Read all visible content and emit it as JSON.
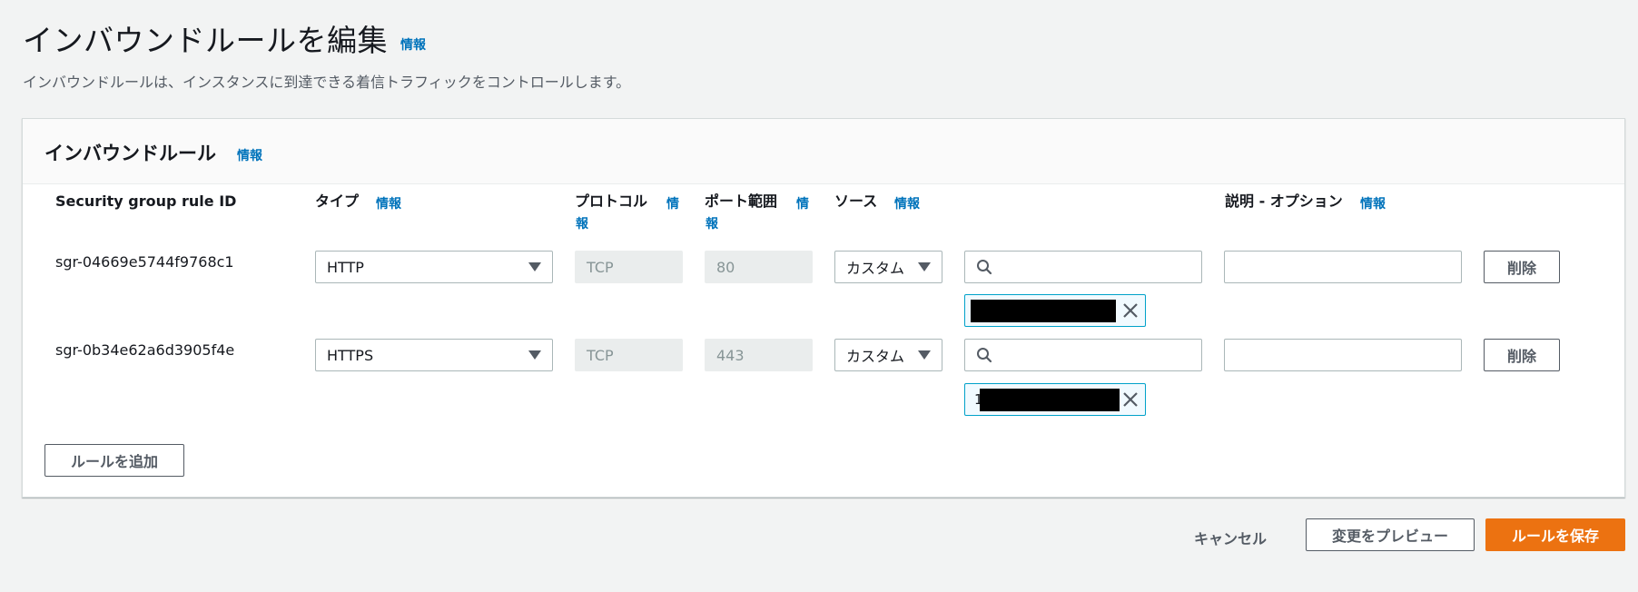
{
  "page": {
    "title": "インバウンドルールを編集",
    "info_label": "情報",
    "description": "インバウンドルールは、インスタンスに到達できる着信トラフィックをコントロールします。"
  },
  "panel": {
    "title": "インバウンドルール",
    "info_label": "情報",
    "columns": {
      "rule_id": "Security group rule ID",
      "type": "タイプ",
      "protocol": "プロトコル",
      "port_range": "ポート範囲",
      "source": "ソース",
      "description": "説明 - オプション",
      "info_label": "情報"
    },
    "rules": [
      {
        "id": "sgr-04669e5744f9768c1",
        "type": "HTTP",
        "protocol": "TCP",
        "port_range": "80",
        "source_mode": "カスタム",
        "source_search": "",
        "source_token_prefix": "",
        "description": "",
        "delete_label": "削除"
      },
      {
        "id": "sgr-0b34e62a6d3905f4e",
        "type": "HTTPS",
        "protocol": "TCP",
        "port_range": "443",
        "source_mode": "カスタム",
        "source_search": "",
        "source_token_prefix": "1",
        "description": "",
        "delete_label": "削除"
      }
    ],
    "add_rule_label": "ルールを追加"
  },
  "footer": {
    "cancel_label": "キャンセル",
    "preview_label": "変更をプレビュー",
    "save_label": "ルールを保存"
  },
  "colors": {
    "accent_link": "#0073bb",
    "primary_button": "#ec7211",
    "token_border": "#00a1c9"
  },
  "icons": [
    "search-icon",
    "close-icon",
    "chevron-down-icon"
  ]
}
